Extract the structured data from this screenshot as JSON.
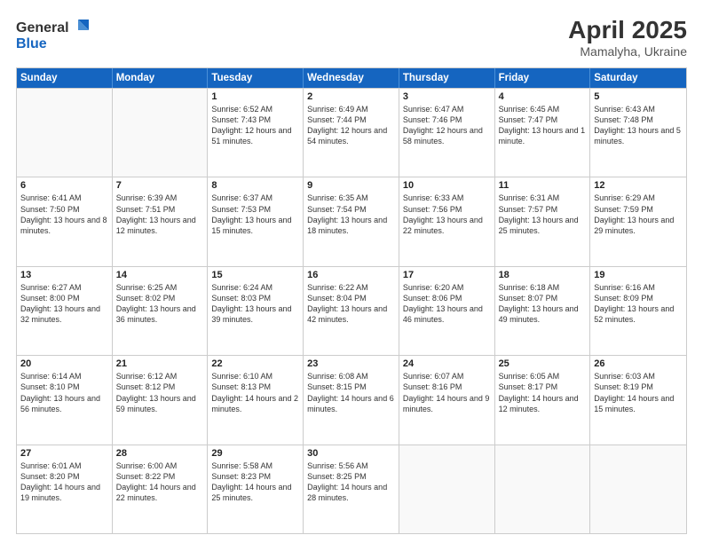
{
  "header": {
    "logo_general": "General",
    "logo_blue": "Blue",
    "title": "April 2025",
    "location": "Mamalyha, Ukraine"
  },
  "days_of_week": [
    "Sunday",
    "Monday",
    "Tuesday",
    "Wednesday",
    "Thursday",
    "Friday",
    "Saturday"
  ],
  "weeks": [
    [
      {
        "day": "",
        "empty": true
      },
      {
        "day": "",
        "empty": true
      },
      {
        "day": "1",
        "sunrise": "Sunrise: 6:52 AM",
        "sunset": "Sunset: 7:43 PM",
        "daylight": "Daylight: 12 hours and 51 minutes."
      },
      {
        "day": "2",
        "sunrise": "Sunrise: 6:49 AM",
        "sunset": "Sunset: 7:44 PM",
        "daylight": "Daylight: 12 hours and 54 minutes."
      },
      {
        "day": "3",
        "sunrise": "Sunrise: 6:47 AM",
        "sunset": "Sunset: 7:46 PM",
        "daylight": "Daylight: 12 hours and 58 minutes."
      },
      {
        "day": "4",
        "sunrise": "Sunrise: 6:45 AM",
        "sunset": "Sunset: 7:47 PM",
        "daylight": "Daylight: 13 hours and 1 minute."
      },
      {
        "day": "5",
        "sunrise": "Sunrise: 6:43 AM",
        "sunset": "Sunset: 7:48 PM",
        "daylight": "Daylight: 13 hours and 5 minutes."
      }
    ],
    [
      {
        "day": "6",
        "sunrise": "Sunrise: 6:41 AM",
        "sunset": "Sunset: 7:50 PM",
        "daylight": "Daylight: 13 hours and 8 minutes."
      },
      {
        "day": "7",
        "sunrise": "Sunrise: 6:39 AM",
        "sunset": "Sunset: 7:51 PM",
        "daylight": "Daylight: 13 hours and 12 minutes."
      },
      {
        "day": "8",
        "sunrise": "Sunrise: 6:37 AM",
        "sunset": "Sunset: 7:53 PM",
        "daylight": "Daylight: 13 hours and 15 minutes."
      },
      {
        "day": "9",
        "sunrise": "Sunrise: 6:35 AM",
        "sunset": "Sunset: 7:54 PM",
        "daylight": "Daylight: 13 hours and 18 minutes."
      },
      {
        "day": "10",
        "sunrise": "Sunrise: 6:33 AM",
        "sunset": "Sunset: 7:56 PM",
        "daylight": "Daylight: 13 hours and 22 minutes."
      },
      {
        "day": "11",
        "sunrise": "Sunrise: 6:31 AM",
        "sunset": "Sunset: 7:57 PM",
        "daylight": "Daylight: 13 hours and 25 minutes."
      },
      {
        "day": "12",
        "sunrise": "Sunrise: 6:29 AM",
        "sunset": "Sunset: 7:59 PM",
        "daylight": "Daylight: 13 hours and 29 minutes."
      }
    ],
    [
      {
        "day": "13",
        "sunrise": "Sunrise: 6:27 AM",
        "sunset": "Sunset: 8:00 PM",
        "daylight": "Daylight: 13 hours and 32 minutes."
      },
      {
        "day": "14",
        "sunrise": "Sunrise: 6:25 AM",
        "sunset": "Sunset: 8:02 PM",
        "daylight": "Daylight: 13 hours and 36 minutes."
      },
      {
        "day": "15",
        "sunrise": "Sunrise: 6:24 AM",
        "sunset": "Sunset: 8:03 PM",
        "daylight": "Daylight: 13 hours and 39 minutes."
      },
      {
        "day": "16",
        "sunrise": "Sunrise: 6:22 AM",
        "sunset": "Sunset: 8:04 PM",
        "daylight": "Daylight: 13 hours and 42 minutes."
      },
      {
        "day": "17",
        "sunrise": "Sunrise: 6:20 AM",
        "sunset": "Sunset: 8:06 PM",
        "daylight": "Daylight: 13 hours and 46 minutes."
      },
      {
        "day": "18",
        "sunrise": "Sunrise: 6:18 AM",
        "sunset": "Sunset: 8:07 PM",
        "daylight": "Daylight: 13 hours and 49 minutes."
      },
      {
        "day": "19",
        "sunrise": "Sunrise: 6:16 AM",
        "sunset": "Sunset: 8:09 PM",
        "daylight": "Daylight: 13 hours and 52 minutes."
      }
    ],
    [
      {
        "day": "20",
        "sunrise": "Sunrise: 6:14 AM",
        "sunset": "Sunset: 8:10 PM",
        "daylight": "Daylight: 13 hours and 56 minutes."
      },
      {
        "day": "21",
        "sunrise": "Sunrise: 6:12 AM",
        "sunset": "Sunset: 8:12 PM",
        "daylight": "Daylight: 13 hours and 59 minutes."
      },
      {
        "day": "22",
        "sunrise": "Sunrise: 6:10 AM",
        "sunset": "Sunset: 8:13 PM",
        "daylight": "Daylight: 14 hours and 2 minutes."
      },
      {
        "day": "23",
        "sunrise": "Sunrise: 6:08 AM",
        "sunset": "Sunset: 8:15 PM",
        "daylight": "Daylight: 14 hours and 6 minutes."
      },
      {
        "day": "24",
        "sunrise": "Sunrise: 6:07 AM",
        "sunset": "Sunset: 8:16 PM",
        "daylight": "Daylight: 14 hours and 9 minutes."
      },
      {
        "day": "25",
        "sunrise": "Sunrise: 6:05 AM",
        "sunset": "Sunset: 8:17 PM",
        "daylight": "Daylight: 14 hours and 12 minutes."
      },
      {
        "day": "26",
        "sunrise": "Sunrise: 6:03 AM",
        "sunset": "Sunset: 8:19 PM",
        "daylight": "Daylight: 14 hours and 15 minutes."
      }
    ],
    [
      {
        "day": "27",
        "sunrise": "Sunrise: 6:01 AM",
        "sunset": "Sunset: 8:20 PM",
        "daylight": "Daylight: 14 hours and 19 minutes."
      },
      {
        "day": "28",
        "sunrise": "Sunrise: 6:00 AM",
        "sunset": "Sunset: 8:22 PM",
        "daylight": "Daylight: 14 hours and 22 minutes."
      },
      {
        "day": "29",
        "sunrise": "Sunrise: 5:58 AM",
        "sunset": "Sunset: 8:23 PM",
        "daylight": "Daylight: 14 hours and 25 minutes."
      },
      {
        "day": "30",
        "sunrise": "Sunrise: 5:56 AM",
        "sunset": "Sunset: 8:25 PM",
        "daylight": "Daylight: 14 hours and 28 minutes."
      },
      {
        "day": "",
        "empty": true
      },
      {
        "day": "",
        "empty": true
      },
      {
        "day": "",
        "empty": true
      }
    ]
  ]
}
